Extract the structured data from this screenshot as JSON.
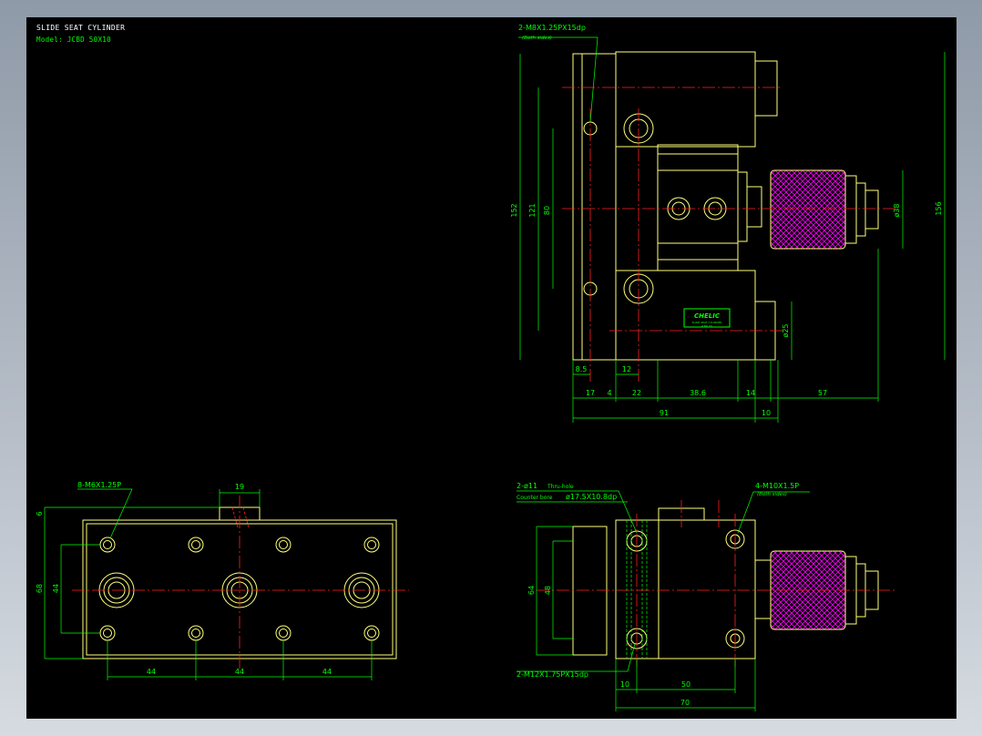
{
  "header": {
    "title": "SLIDE SEAT CYLINDER",
    "model_label": "Model:",
    "model_value": "JCBD 50X10"
  },
  "front_view": {
    "callout_thread": "2-M8X1.25PX15dp",
    "callout_sides": "(Both sides)",
    "dims": {
      "d152": "152",
      "d121": "121",
      "d80": "80",
      "d156": "156",
      "d38": "ø38",
      "d25": "ø25",
      "d8_5": "8.5",
      "d12": "12",
      "d17": "17",
      "d4": "4",
      "d22": "22",
      "d38_6": "38.6",
      "d14": "14",
      "d57": "57",
      "d91": "91",
      "d10": "10"
    },
    "brand": "CHELIC",
    "brand_sub1": "SLIDE SEAT CYLINDER",
    "brand_sub2": "JCBD 50"
  },
  "plan_view": {
    "callout_thread": "8-M6X1.25P",
    "dims": {
      "d19": "19",
      "d6": "6",
      "d68": "68",
      "d44v": "44",
      "d44a": "44",
      "d44b": "44",
      "d44c": "44"
    }
  },
  "side_view": {
    "callout_hole": "2-ø11",
    "callout_hole_note": "Thru-hole",
    "callout_cbore_label": "Counter bore",
    "callout_cbore": "ø17.5X10.8dp",
    "callout_tap": "4-M10X1.5P",
    "callout_tap_sides": "(Both sides)",
    "callout_bottom": "2-M12X1.75PX15dp",
    "dims": {
      "d64": "64",
      "d48": "48",
      "d10": "10",
      "d50": "50",
      "d70": "70"
    }
  },
  "colors": {
    "background": "#000000",
    "outline": "#ffff7a",
    "dimension": "#00ff00",
    "centerline": "#ff2020",
    "hatch": "#ff00ff",
    "frame": "#b8bfc9"
  }
}
